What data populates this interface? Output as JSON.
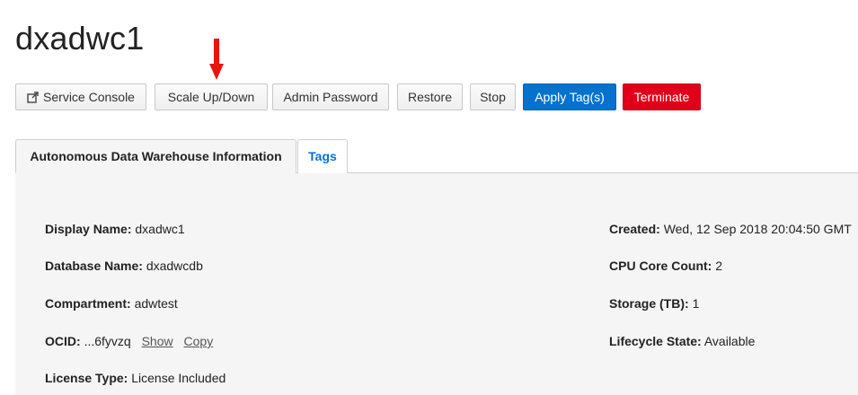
{
  "page": {
    "title": "dxadwc1"
  },
  "toolbar": {
    "service_console": "Service Console",
    "scale": "Scale Up/Down",
    "admin_password": "Admin Password",
    "restore": "Restore",
    "stop": "Stop",
    "apply_tags": "Apply Tag(s)",
    "terminate": "Terminate"
  },
  "tabs": [
    {
      "label": "Autonomous Data Warehouse Information",
      "active": true
    },
    {
      "label": "Tags",
      "active": false
    }
  ],
  "info": {
    "left": [
      {
        "label": "Display Name:",
        "value": "dxadwc1"
      },
      {
        "label": "Database Name:",
        "value": "dxadwcdb"
      },
      {
        "label": "Compartment:",
        "value": "adwtest"
      },
      {
        "label": "OCID:",
        "value": "...6fyvzq",
        "show": "Show",
        "copy": "Copy"
      },
      {
        "label": "License Type:",
        "value": "License Included"
      }
    ],
    "right": [
      {
        "label": "Created:",
        "value": "Wed, 12 Sep 2018 20:04:50 GMT"
      },
      {
        "label": "CPU Core Count:",
        "value": "2"
      },
      {
        "label": "Storage (TB):",
        "value": "1"
      },
      {
        "label": "Lifecycle State:",
        "value": "Available"
      }
    ]
  },
  "colors": {
    "primary": "#0572ce",
    "danger": "#e0001a",
    "annotation_arrow": "#e8150e"
  },
  "icons": {
    "annotation": "red-down-arrow-icon",
    "external": "external-link-icon"
  }
}
